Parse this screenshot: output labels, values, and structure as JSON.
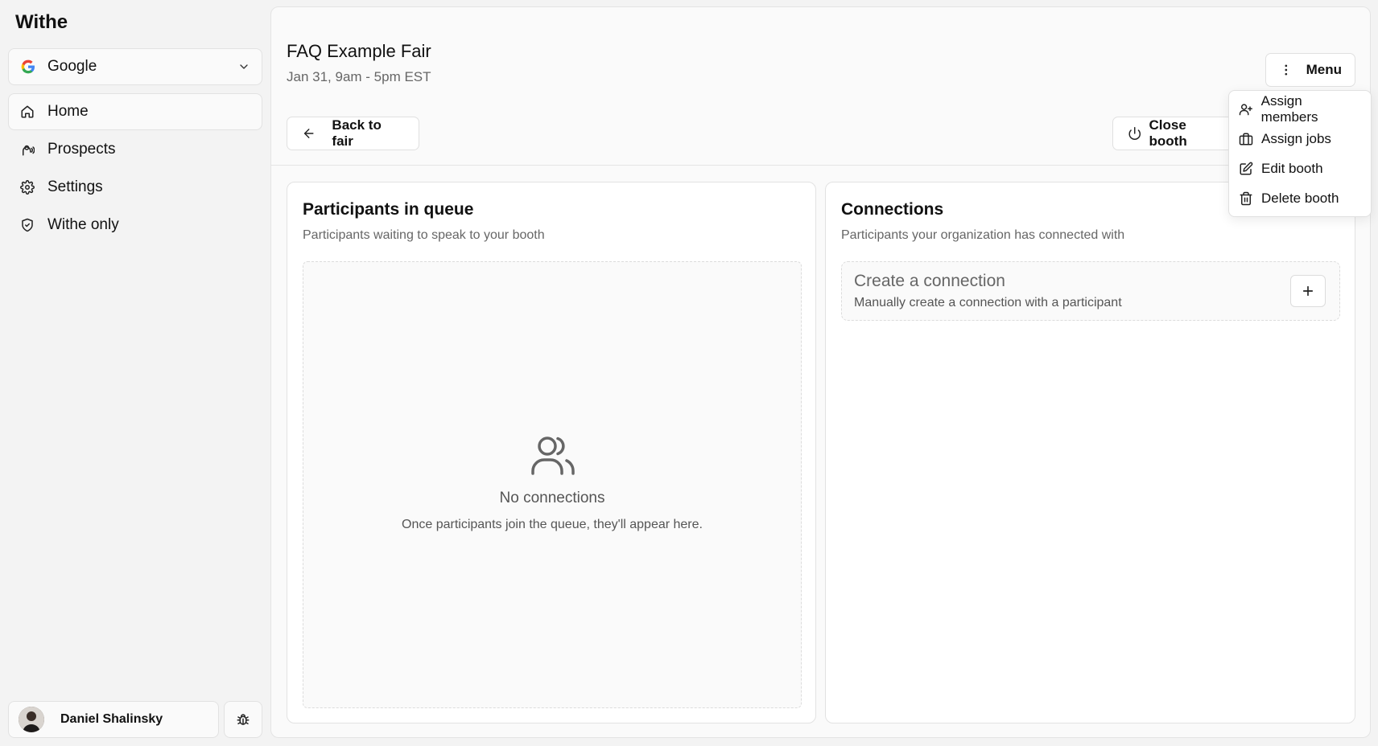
{
  "sidebar": {
    "brand": "Withe",
    "org_select": {
      "value": "Google",
      "logo_icon": "google-logo-icon"
    },
    "nav": [
      {
        "label": "Home",
        "icon": "home-icon",
        "active": true
      },
      {
        "label": "Prospects",
        "icon": "prospects-icon",
        "active": false
      },
      {
        "label": "Settings",
        "icon": "gear-icon",
        "active": false
      },
      {
        "label": "Withe only",
        "icon": "shield-icon",
        "active": false
      }
    ],
    "user": {
      "name": "Daniel Shalinsky"
    }
  },
  "header": {
    "title": "FAQ Example Fair",
    "date": "Jan 31, 9am - 5pm EST",
    "menu_label": "Menu",
    "back_label": "Back to fair",
    "close_label": "Close booth"
  },
  "queue": {
    "title": "Participants in queue",
    "subtitle": "Participants waiting to speak to your booth",
    "empty_title": "No connections",
    "empty_desc": "Once participants join the queue, they'll appear here."
  },
  "connections": {
    "title": "Connections",
    "subtitle": "Participants your organization has connected with",
    "create_title": "Create a connection",
    "create_desc": "Manually create a connection with a participant"
  },
  "dropdown": [
    {
      "label": "Assign members",
      "icon": "user-plus-icon"
    },
    {
      "label": "Assign jobs",
      "icon": "briefcase-icon"
    },
    {
      "label": "Edit booth",
      "icon": "edit-icon"
    },
    {
      "label": "Delete booth",
      "icon": "trash-icon"
    }
  ],
  "colors": {
    "background": "#f3f3f3",
    "panel": "#fafafa",
    "card": "#ffffff",
    "border": "#e2e2e2",
    "text": "#111111",
    "muted": "#666666"
  }
}
